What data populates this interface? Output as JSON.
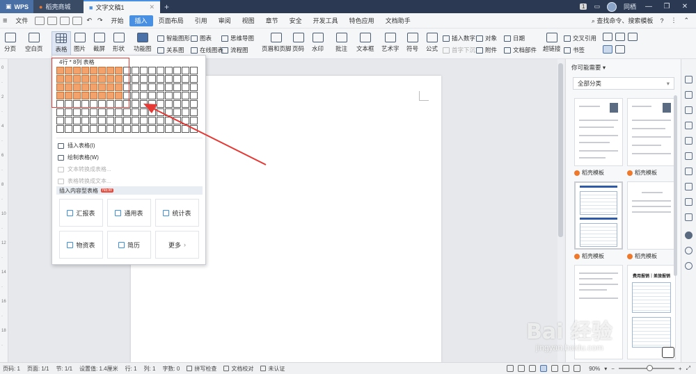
{
  "titlebar": {
    "tabs": [
      {
        "label": "WPS",
        "icon": "wps-logo-icon"
      },
      {
        "label": "稻壳商城",
        "icon": "daoke-icon"
      },
      {
        "label": "文字文稿1",
        "icon": "doc-icon"
      }
    ],
    "notification_count": "1",
    "user": "同栖"
  },
  "menubar": {
    "file_label": "文件",
    "items": [
      "开始",
      "插入",
      "页面布局",
      "引用",
      "审阅",
      "视图",
      "章节",
      "安全",
      "开发工具",
      "特色应用",
      "文档助手"
    ],
    "active": "插入",
    "search_label": "查找命令、搜索模板"
  },
  "ribbon": {
    "page_break": "分页",
    "blank_page": "空白页",
    "table": "表格",
    "picture": "图片",
    "screenshot": "截屏",
    "shape": "形状",
    "function_chart": "功能图",
    "smart_shape": "智能图形",
    "chart": "图表",
    "mind_map": "思维导图",
    "relation_chart": "关系图",
    "online_chart": "在线图表",
    "flowchart": "流程图",
    "header_footer": "页眉和页脚",
    "page_number": "页码",
    "watermark": "水印",
    "comment": "批注",
    "text_box": "文本框",
    "art_text": "艺术字",
    "symbol": "符号",
    "formula": "公式",
    "insert_number": "插入数字",
    "object": "对象",
    "date": "日期",
    "drop_cap": "首字下沉",
    "attachment": "附件",
    "doc_parts": "文档部件",
    "hyperlink": "超链接",
    "cross_ref": "交叉引用",
    "bookmark": "书签"
  },
  "table_dropdown": {
    "size_label": "4行 * 8列 表格",
    "rows_selected": 4,
    "cols_selected": 8,
    "grid_rows": 8,
    "grid_cols": 17,
    "menu": [
      {
        "label": "插入表格(I)",
        "enabled": true
      },
      {
        "label": "绘制表格(W)",
        "enabled": true
      },
      {
        "label": "文本转换成表格...",
        "enabled": false
      },
      {
        "label": "表格转换成文本...",
        "enabled": false
      }
    ],
    "section_title": "插入内容型表格",
    "new_badge": "NEW",
    "templates": [
      "汇报表",
      "通用表",
      "统计表",
      "物资表",
      "简历",
      "更多"
    ]
  },
  "right_panel": {
    "title": "你可能需要",
    "filter": "全部分类",
    "template_label": "稻壳模板",
    "doc_title": "费用报销｜差旅报销"
  },
  "statusbar": {
    "page_num": "页码: 1",
    "pages": "页面: 1/1",
    "section": "节: 1/1",
    "setting": "设置值: 1.4厘米",
    "row": "行: 1",
    "col": "列: 1",
    "word_count": "字数: 0",
    "spell_check": "拼写检查",
    "doc_check": "文档校对",
    "auth": "未认证",
    "zoom": "90%",
    "zoom_value": 0.55
  },
  "watermark": {
    "text": "Bai 经验",
    "sub": "jingyan.baidu.com"
  },
  "colors": {
    "selected_cell": "#f4a26b",
    "highlight_box": "#e53935",
    "accent": "#4a90e2"
  }
}
